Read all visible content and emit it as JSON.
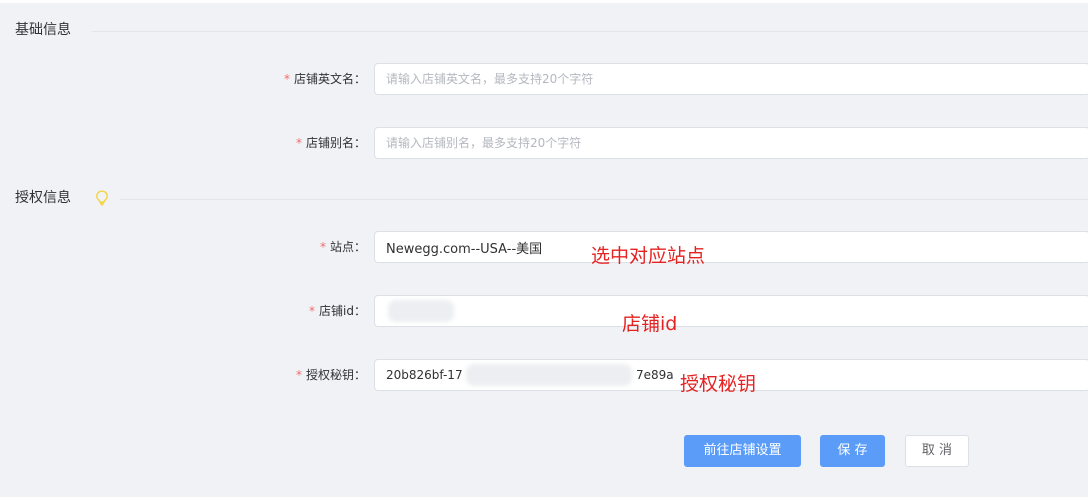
{
  "sections": {
    "basic": {
      "title": "基础信息"
    },
    "auth": {
      "title": "授权信息"
    }
  },
  "fields": {
    "store_en_name": {
      "label": "店铺英文名：",
      "required": "*",
      "value": "",
      "placeholder": "请输入店铺英文名，最多支持20个字符"
    },
    "store_alias": {
      "label": "店铺别名：",
      "required": "*",
      "value": "",
      "placeholder": "请输入店铺别名，最多支持20个字符"
    },
    "site": {
      "label": "站点：",
      "required": "*",
      "value": "Newegg.com--USA--美国"
    },
    "store_id": {
      "label": "店铺id：",
      "required": "*",
      "value": ""
    },
    "auth_key": {
      "label": "授权秘钥：",
      "required": "*",
      "value_prefix": "20b826bf-17",
      "value_suffix": "7e89a"
    }
  },
  "annotations": {
    "site_note": "选中对应站点",
    "store_id_note": "店铺id",
    "auth_key_note": "授权秘钥"
  },
  "buttons": {
    "goto_settings": "前往店铺设置",
    "save": "保 存",
    "cancel": "取 消"
  },
  "colors": {
    "primary": "#5a9cf8",
    "required": "#f56c6c",
    "annotation": "#e52222",
    "background": "#f0f2f5",
    "bulb": "#f5d442"
  },
  "icons": {
    "tip": "lightbulb-icon"
  }
}
